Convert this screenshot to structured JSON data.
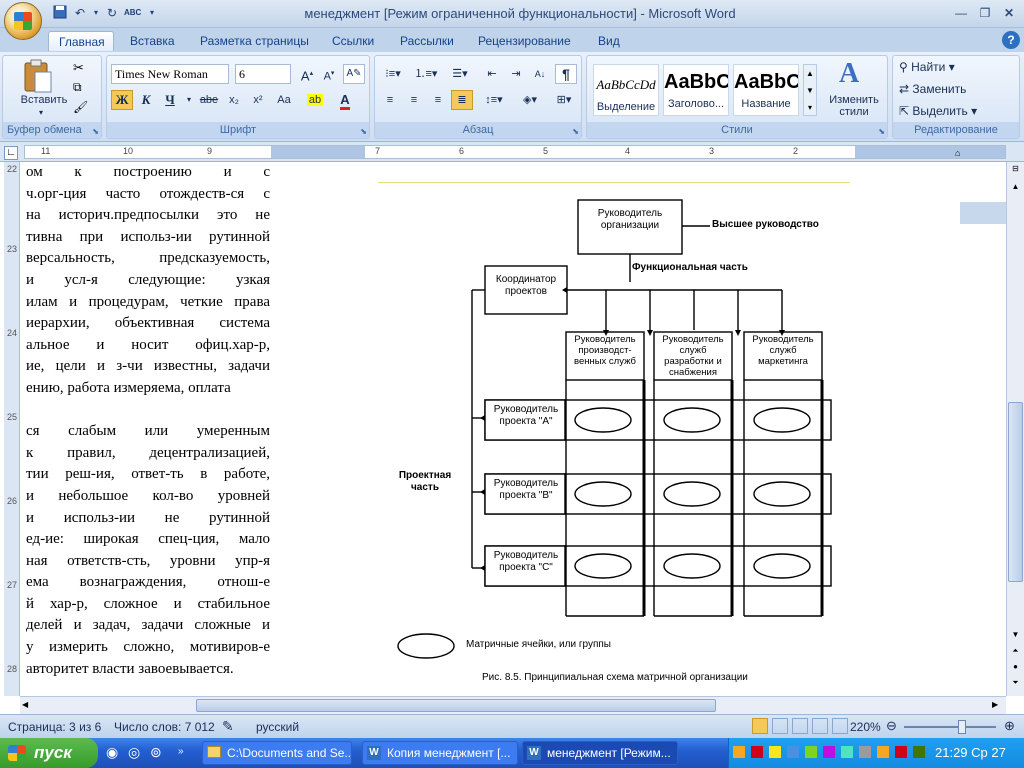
{
  "window": {
    "title": "менеджмент [Режим ограниченной функциональности] - Microsoft Word"
  },
  "quick_access": {
    "icons": [
      "save-icon",
      "undo-icon",
      "redo-icon",
      "spellcheck-icon",
      "customize-icon"
    ]
  },
  "tabs": [
    "Главная",
    "Вставка",
    "Разметка страницы",
    "Ссылки",
    "Рассылки",
    "Рецензирование",
    "Вид"
  ],
  "ribbon": {
    "clipboard": {
      "label": "Буфер обмена",
      "paste": "Вставить"
    },
    "font": {
      "label": "Шрифт",
      "font_name": "Times New Roman",
      "font_size": "6",
      "bold": "Ж",
      "italic": "К",
      "underline": "Ч",
      "strike": "abe",
      "sub": "x₂",
      "sup": "x²",
      "case": "Aa"
    },
    "paragraph": {
      "label": "Абзац"
    },
    "styles": {
      "label": "Стили",
      "items": [
        {
          "sample": "AaBbCcDd",
          "name": "Выделение"
        },
        {
          "sample": "AaBbC",
          "name": "Заголово..."
        },
        {
          "sample": "AaBbC",
          "name": "Название"
        }
      ],
      "change": "Изменить стили"
    },
    "editing": {
      "label": "Редактирование",
      "find": "Найти",
      "replace": "Заменить",
      "select": "Выделить"
    }
  },
  "ruler": {
    "marks": [
      "11",
      "10",
      "9",
      "7",
      "6",
      "5",
      "4",
      "3",
      "2"
    ]
  },
  "vruler": {
    "marks": [
      "22",
      "23",
      "24",
      "25",
      "26",
      "27",
      "28"
    ]
  },
  "document": {
    "lines": [
      "ом к построению и с",
      "ч.орг-ция часто отождеств-ся с",
      "на историч.предпосылки это не",
      "тивна при использ-ии рутинной",
      "версальность, предсказуемость,",
      "и усл-я следующие: узкая",
      "илам и процедурам, четкие права",
      "иерархии, объективная система",
      "альное и носит офиц.хар-р,",
      "ие, цели и з-чи известны, задачи",
      "ению, работа измеряема, оплата",
      "",
      "ся слабым или умеренным",
      "к правил, децентрализацией,",
      "тии реш-ия, ответ-ть в работе,",
      "и небольшое кол-во уровней",
      "и использ-ии не рутинной",
      "ед-ие: широкая спец-ция, мало",
      "ная ответств-сть, уровни упр-я",
      "ема вознаграждения, отнош-е",
      "й хар-р, сложное и стабильное",
      "делей и задач, задачи сложные и",
      "у измерить сложно, мотивиров-е",
      "авторитет власти завоевывается."
    ]
  },
  "figure": {
    "head": "Руководитель организации",
    "top_mgmt": "Высшее руководство",
    "functional": "Функциональная часть",
    "coordinator": "Координатор проектов",
    "func_heads": [
      "Руководитель производст- венных служб",
      "Руководитель служб разработки и снабжения",
      "Руководитель служб маркетинга"
    ],
    "projects": [
      "Руководитель проекта \"А\"",
      "Руководитель проекта \"В\"",
      "Руководитель проекта \"С\""
    ],
    "project_part": "Проектная часть",
    "legend": "Матричные ячейки, или группы",
    "caption": "Рис. 8.5. Принципиальная схема матричной организации"
  },
  "status": {
    "page": "Страница: 3 из 6",
    "words": "Число слов: 7 012",
    "language": "русский",
    "zoom": "220%"
  },
  "taskbar": {
    "start": "пуск",
    "items": [
      "C:\\Documents and Se...",
      "Копия менеджмент [...",
      "менеджмент [Режим..."
    ],
    "clock": "21:29 Ср 27"
  }
}
